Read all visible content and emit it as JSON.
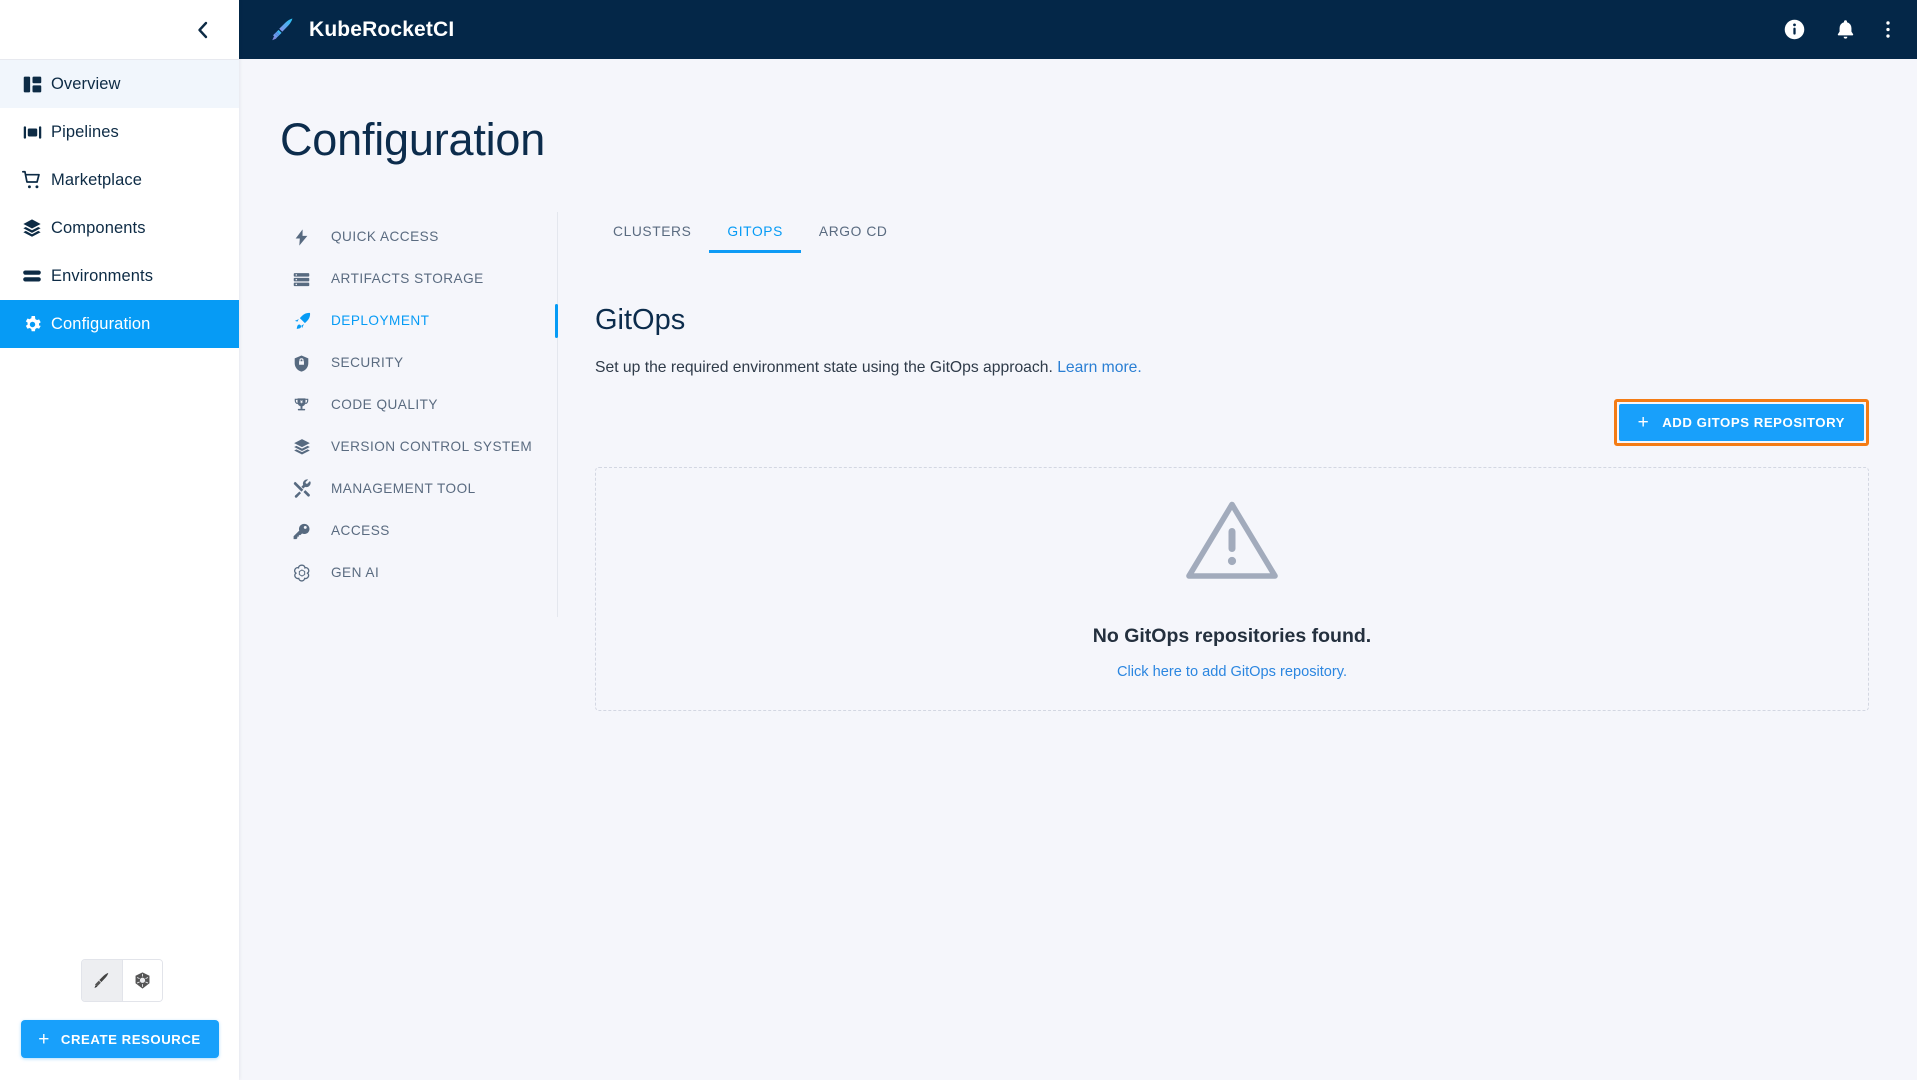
{
  "sidebar": {
    "collapse_icon": "chevron-left-icon",
    "items": [
      {
        "label": "Overview",
        "icon": "dashboard-icon",
        "state": "hovered"
      },
      {
        "label": "Pipelines",
        "icon": "pipelines-icon",
        "state": "normal"
      },
      {
        "label": "Marketplace",
        "icon": "cart-icon",
        "state": "normal"
      },
      {
        "label": "Components",
        "icon": "layers-icon",
        "state": "normal"
      },
      {
        "label": "Environments",
        "icon": "environments-icon",
        "state": "normal"
      },
      {
        "label": "Configuration",
        "icon": "gear-icon",
        "state": "active"
      }
    ],
    "view_toggle": [
      {
        "icon": "kuberocketci-logo-icon",
        "selected": true
      },
      {
        "icon": "kubernetes-icon",
        "selected": false
      }
    ],
    "create_resource_label": "CREATE RESOURCE",
    "create_resource_plus": "+"
  },
  "topbar": {
    "brand": "KubeRocketCI",
    "logo_icon": "kuberocketci-logo-icon",
    "actions": [
      {
        "icon": "info-icon"
      },
      {
        "icon": "bell-icon"
      },
      {
        "icon": "more-vertical-icon"
      }
    ]
  },
  "page": {
    "title": "Configuration"
  },
  "settings_menu": {
    "items": [
      {
        "label": "QUICK ACCESS",
        "icon": "lightning-bolt-icon",
        "active": false
      },
      {
        "label": "ARTIFACTS STORAGE",
        "icon": "storage-icon",
        "active": false
      },
      {
        "label": "DEPLOYMENT",
        "icon": "rocket-icon",
        "active": true
      },
      {
        "label": "SECURITY",
        "icon": "shield-icon",
        "active": false
      },
      {
        "label": "CODE QUALITY",
        "icon": "trophy-icon",
        "active": false
      },
      {
        "label": "VERSION CONTROL SYSTEM",
        "icon": "layers-icon",
        "active": false
      },
      {
        "label": "MANAGEMENT TOOL",
        "icon": "tools-icon",
        "active": false
      },
      {
        "label": "ACCESS",
        "icon": "key-icon",
        "active": false
      },
      {
        "label": "GEN AI",
        "icon": "gen-ai-icon",
        "active": false
      }
    ]
  },
  "panel": {
    "tabs": [
      {
        "label": "CLUSTERS",
        "active": false
      },
      {
        "label": "GITOPS",
        "active": true
      },
      {
        "label": "ARGO CD",
        "active": false
      }
    ],
    "section_title": "GitOps",
    "section_desc": "Set up the required environment state using the GitOps approach.",
    "section_desc_link": "Learn more.",
    "add_button_label": "ADD GITOPS REPOSITORY",
    "add_button_plus": "+",
    "empty_state": {
      "icon": "warning-triangle-icon",
      "title": "No GitOps repositories found.",
      "link": "Click here to add GitOps repository."
    }
  },
  "colors": {
    "topbar_bg": "#042748",
    "accent_blue": "#069BF5",
    "button_blue": "#18A0FB",
    "highlight_orange": "#F47C15",
    "page_bg": "#F5F6FB",
    "title_navy": "#0C2C4C",
    "muted_slate": "#5A6B80"
  }
}
